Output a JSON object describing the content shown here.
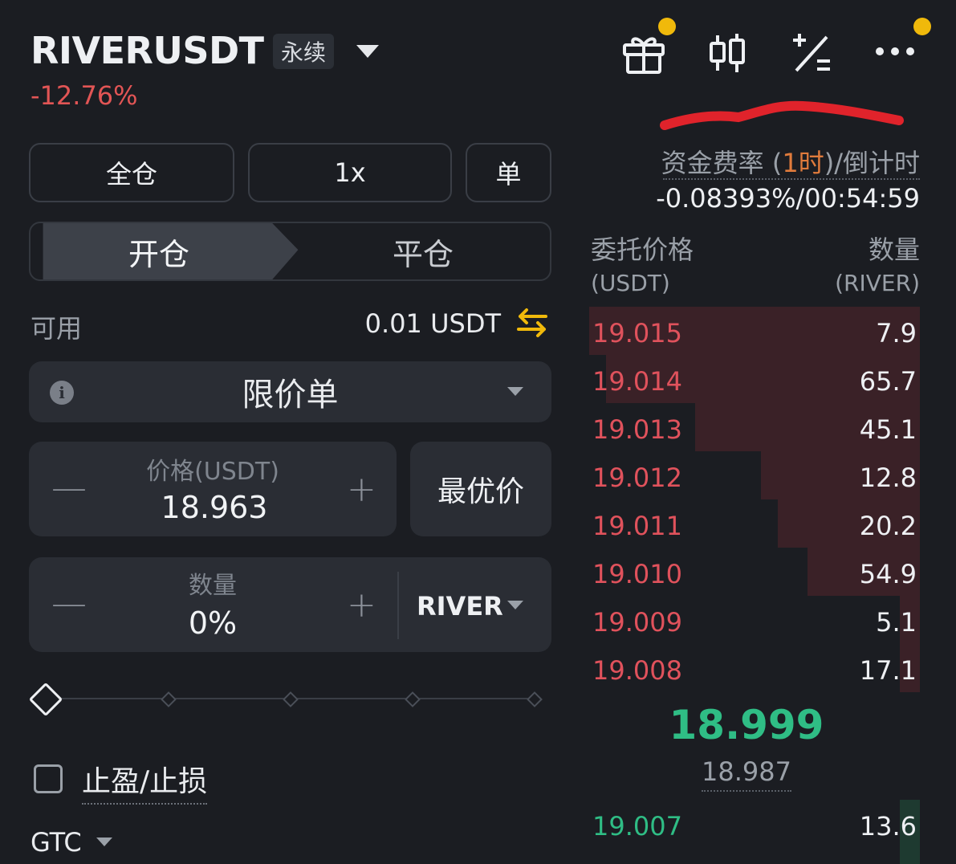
{
  "header": {
    "symbol": "RIVERUSDT",
    "contract_type": "永续",
    "change_pct": "-12.76%",
    "icons": [
      "gift-icon",
      "candlestick-chart-icon",
      "calculator-icon",
      "more-icon"
    ]
  },
  "controls": {
    "margin_mode": "全仓",
    "leverage": "1x",
    "position_mode": "单",
    "tab_open": "开仓",
    "tab_close": "平仓",
    "available_label": "可用",
    "available_value": "0.01 USDT",
    "order_type": "限价单",
    "price_label": "价格(USDT)",
    "price_value": "18.963",
    "best_price": "最优价",
    "qty_label": "数量",
    "qty_value": "0%",
    "qty_unit": "RIVER",
    "tpsl_label": "止盈/止损",
    "tif": "GTC",
    "minus": "—",
    "plus": "+"
  },
  "orderbook": {
    "funding_label_pre": "资金费率 (",
    "funding_interval": "1时",
    "funding_label_post": ")/倒计时",
    "funding_value": "-0.08393%/00:54:59",
    "price_header": "委托价格",
    "qty_header": "数量",
    "price_unit": "(USDT)",
    "qty_unit": "(RIVER)",
    "asks": [
      {
        "price": "19.015",
        "qty": "7.9",
        "depth": 1.0
      },
      {
        "price": "19.014",
        "qty": "65.7",
        "depth": 0.95
      },
      {
        "price": "19.013",
        "qty": "45.1",
        "depth": 0.68
      },
      {
        "price": "19.012",
        "qty": "12.8",
        "depth": 0.48
      },
      {
        "price": "19.011",
        "qty": "20.2",
        "depth": 0.43
      },
      {
        "price": "19.010",
        "qty": "54.9",
        "depth": 0.34
      },
      {
        "price": "19.009",
        "qty": "5.1",
        "depth": 0.06
      },
      {
        "price": "19.008",
        "qty": "17.1",
        "depth": 0.06
      }
    ],
    "last_price": "18.999",
    "mark_price": "18.987",
    "bids": [
      {
        "price": "19.007",
        "qty": "13.6",
        "depth": 0.06
      }
    ]
  },
  "colors": {
    "up": "#2fbd85",
    "down": "#e0525c",
    "accent": "#f0b90b",
    "funding_highlight": "#e07b3c"
  }
}
